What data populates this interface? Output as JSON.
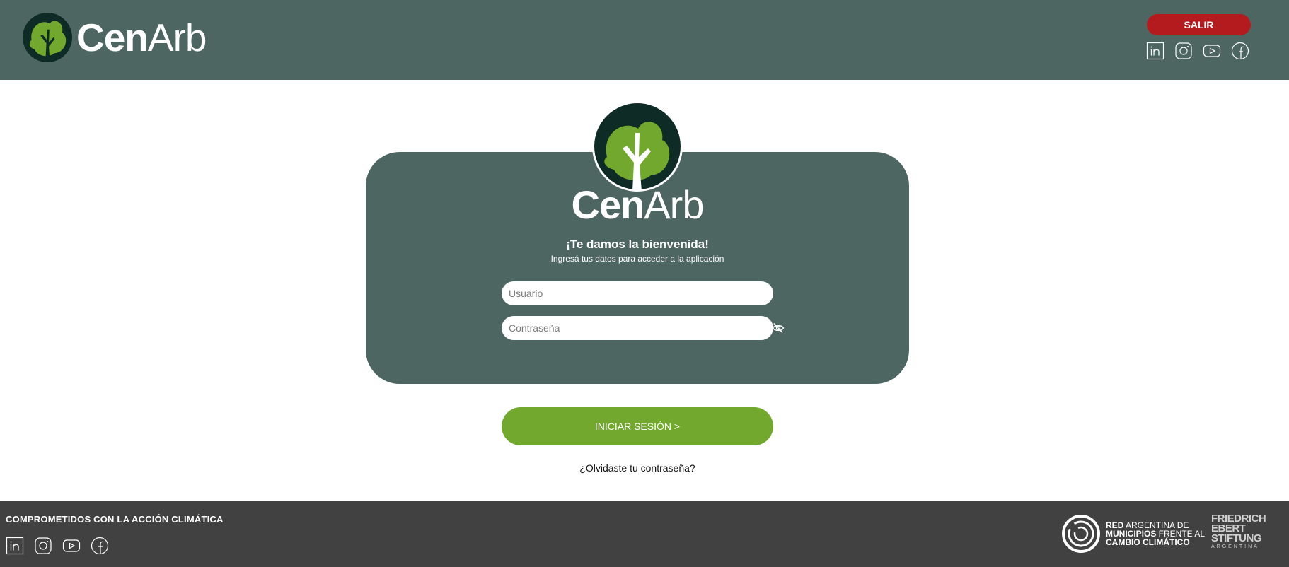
{
  "header": {
    "logo_text_bold": "Cen",
    "logo_text_light": "Arb",
    "logout_label": "SALIR",
    "social_icons": [
      "linkedin-icon",
      "instagram-icon",
      "youtube-icon",
      "facebook-icon"
    ]
  },
  "login": {
    "logo_text_bold": "Cen",
    "logo_text_light": "Arb",
    "title": "¡Te damos la bienvenida!",
    "subtitle": "Ingresá tus datos para acceder a la aplicación",
    "username_placeholder": "Usuario",
    "username_value": "",
    "password_placeholder": "Contraseña",
    "password_value": "",
    "toggle_password_icon": "eye-slash-icon",
    "submit_label": "INICIAR SESIÓN >",
    "forgot_label": "¿Olvidaste tu contraseña?"
  },
  "footer": {
    "tagline": "COMPROMETIDOS CON LA ACCIÓN CLIMÁTICA",
    "social_icons": [
      "linkedin-icon",
      "instagram-icon",
      "youtube-icon",
      "facebook-icon"
    ],
    "partner_ramcc": {
      "line1_bold": "RED",
      "line1_rest": " ARGENTINA DE",
      "line2_bold": "MUNICIPIOS",
      "line2_rest": " FRENTE AL",
      "line3_bold": "CAMBIO CLIMÁTICO"
    },
    "partner_fes": {
      "line1": "FRIEDRICH",
      "line2": "EBERT",
      "line3": "STIFTUNG",
      "country": "ARGENTINA"
    }
  },
  "colors": {
    "header_bg": "#4d6662",
    "card_bg": "#4d6662",
    "accent_green": "#72a82e",
    "logout_red": "#b31b1f",
    "footer_bg": "#414141"
  }
}
